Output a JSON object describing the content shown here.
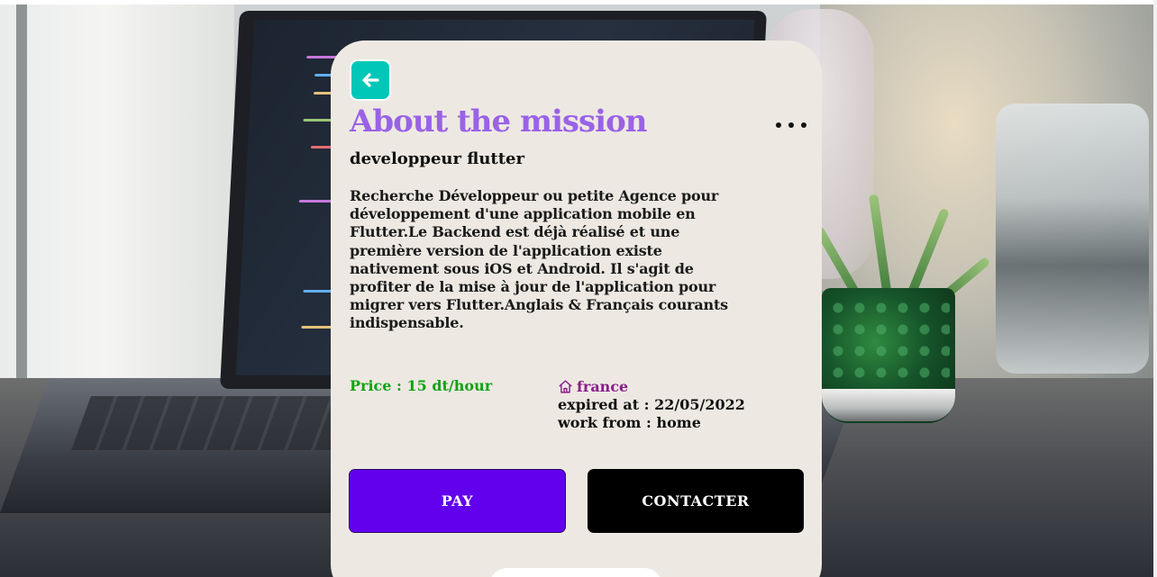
{
  "mission": {
    "title": "About the mission",
    "subtitle": "developpeur flutter",
    "description": "Recherche Développeur ou petite Agence pour développement d'une application mobile en Flutter.Le Backend est déjà réalisé et une première version de l'application existe nativement sous iOS et Android. Il s'agit de profiter de la mise à jour de l'application pour migrer vers Flutter.Anglais & Français courants indispensable.",
    "price": "Price : 15 dt/hour",
    "location": "france",
    "expired": "expired at : 22/05/2022",
    "work_from": "work from : home"
  },
  "actions": {
    "pay_label": "PAY",
    "contact_label": "CONTACTER"
  },
  "icons": {
    "back": "arrow-left-icon",
    "more": "more-horizontal-icon",
    "location": "home-icon"
  },
  "colors": {
    "card_background": "#ede9e2",
    "back_button": "#00c7b7",
    "title": "#9a62e6",
    "price": "#12a312",
    "location": "#8a1c8c",
    "pay_button": "#6200ee",
    "contact_button": "#000000"
  }
}
